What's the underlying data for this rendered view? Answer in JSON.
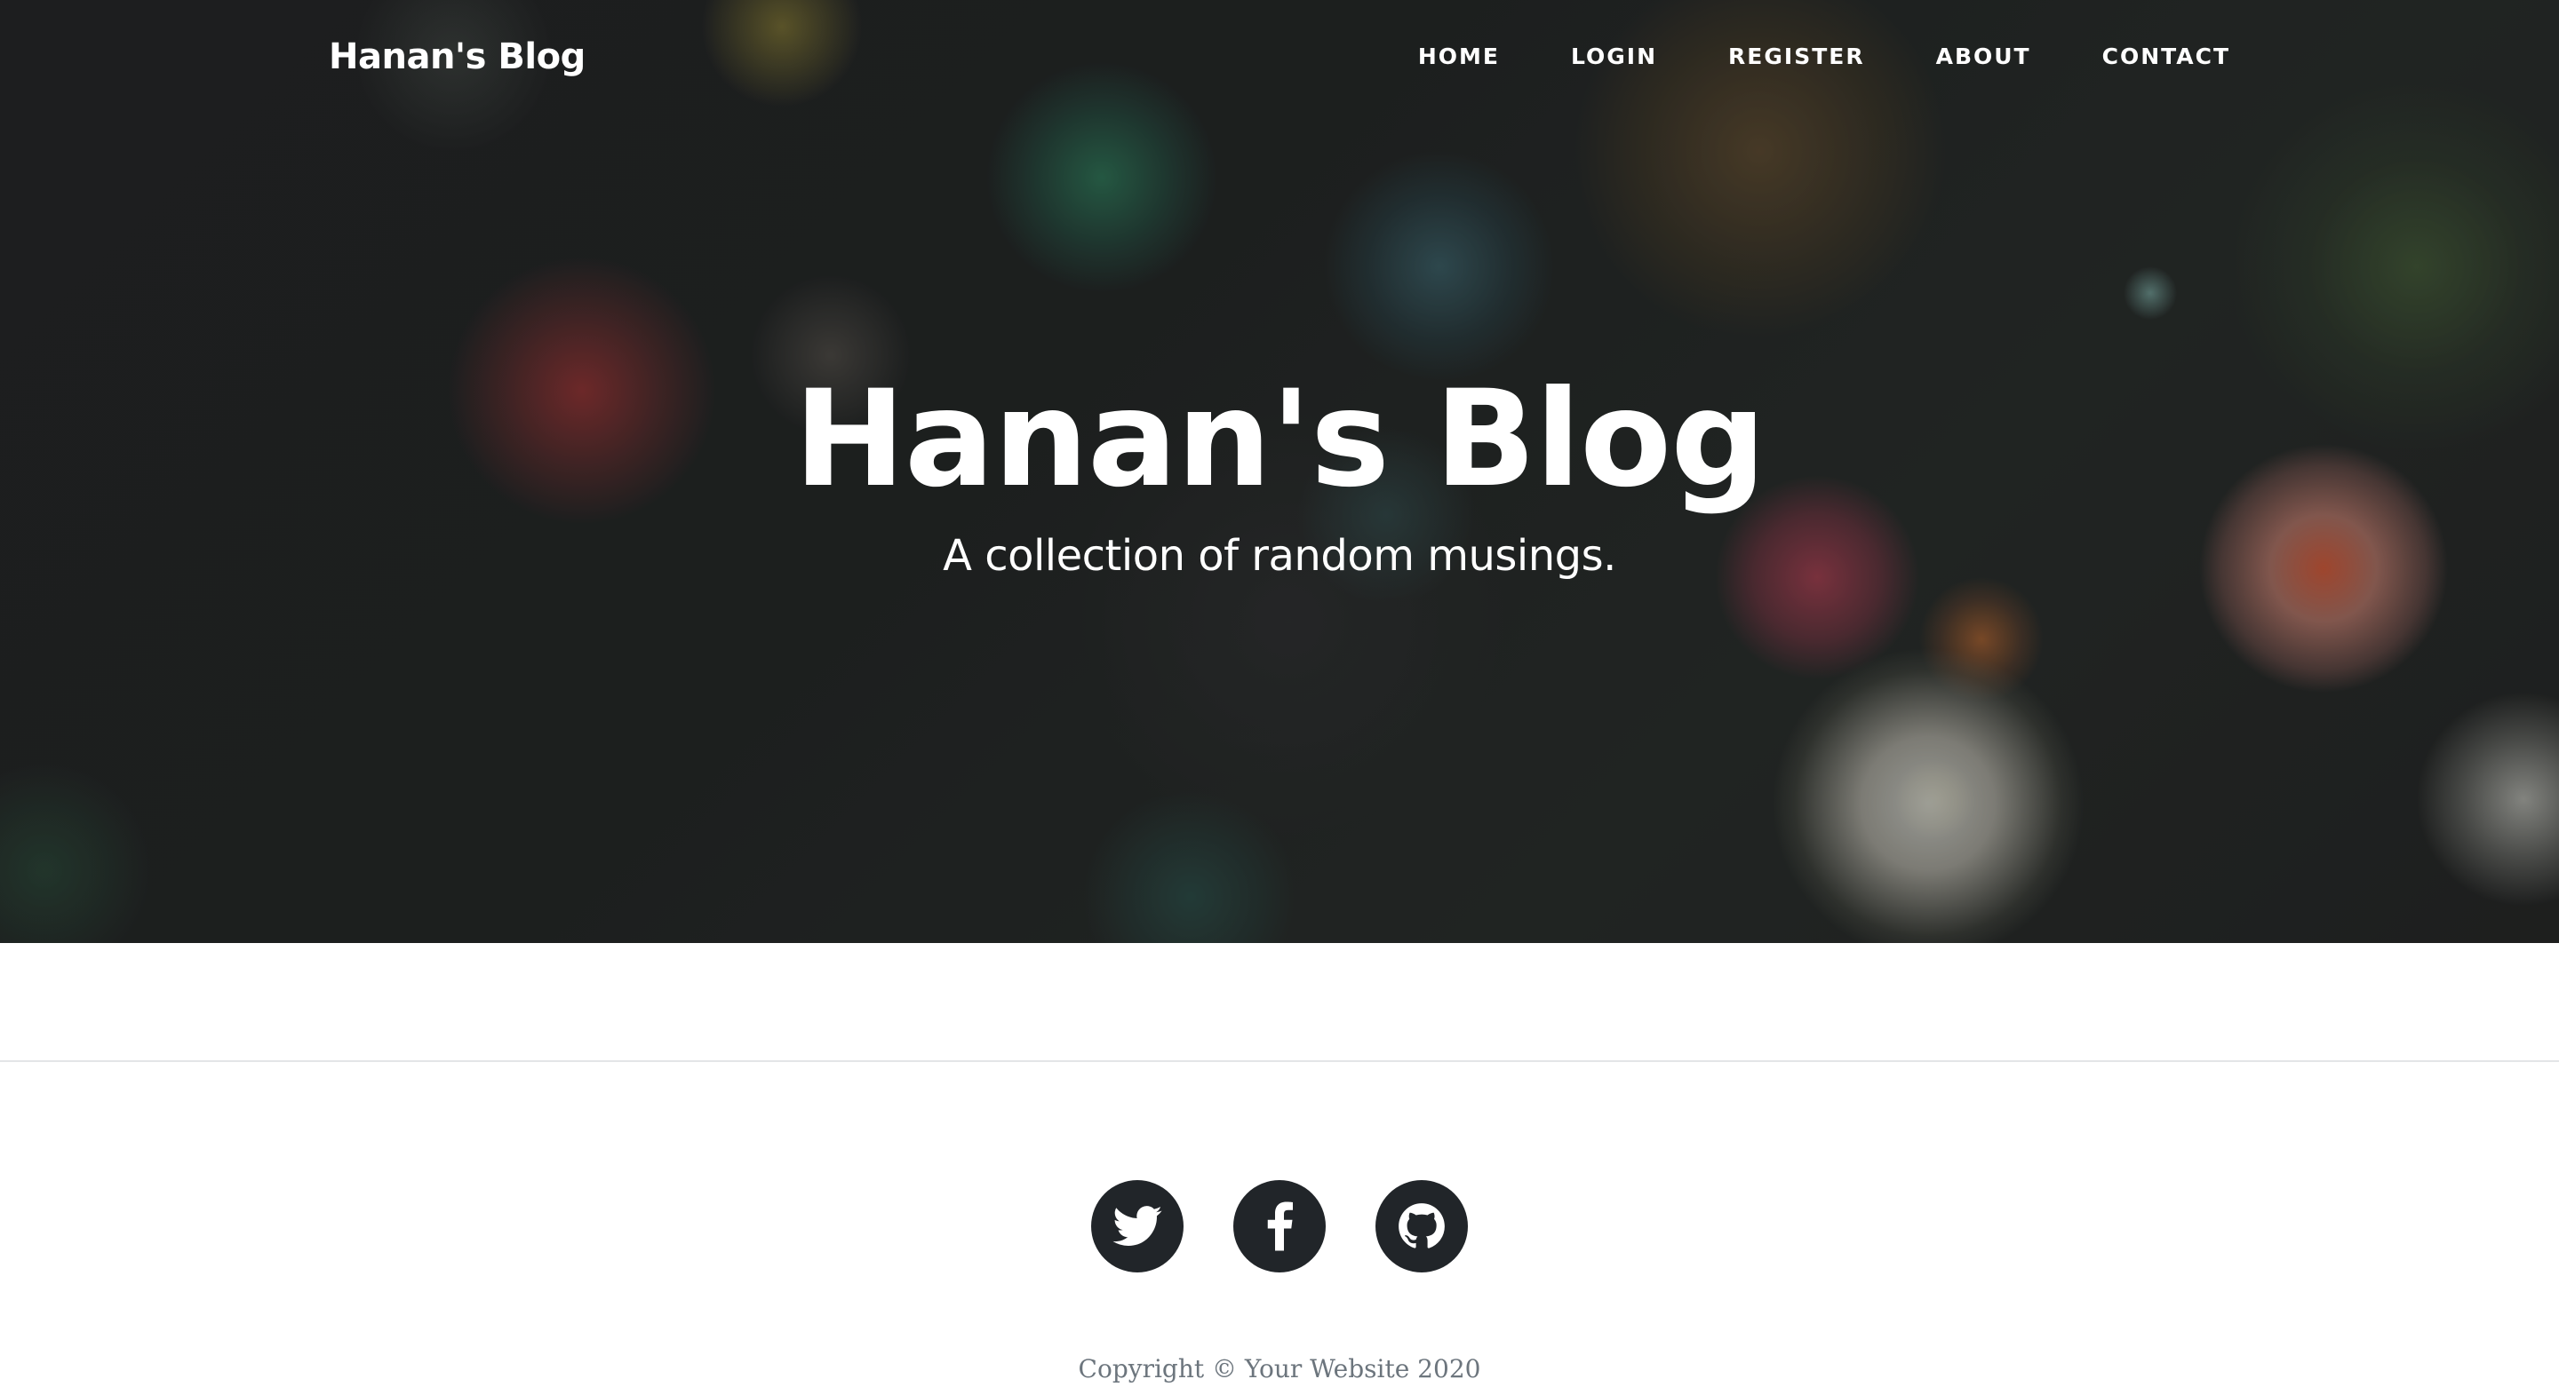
{
  "nav": {
    "brand": "Hanan's Blog",
    "links": [
      {
        "label": "HOME"
      },
      {
        "label": "LOGIN"
      },
      {
        "label": "REGISTER"
      },
      {
        "label": "ABOUT"
      },
      {
        "label": "CONTACT"
      }
    ]
  },
  "hero": {
    "title": "Hanan's Blog",
    "subtitle": "A collection of random musings."
  },
  "footer": {
    "social": [
      {
        "icon": "twitter-icon"
      },
      {
        "icon": "facebook-icon"
      },
      {
        "icon": "github-icon"
      }
    ],
    "copyright": "Copyright © Your Website 2020"
  },
  "colors": {
    "footer_icon_bg": "#212529",
    "copyright_text": "#6c757d",
    "divider": "#e3e5e7"
  }
}
